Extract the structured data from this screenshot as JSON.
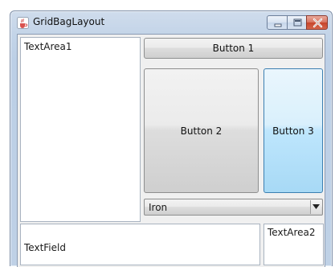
{
  "window": {
    "title": "GridBagLayout",
    "controls": {
      "minimize": "minimize-icon",
      "maximize": "maximize-icon",
      "close": "close-icon"
    }
  },
  "components": {
    "text_area_1": "TextArea1",
    "button_1": "Button 1",
    "button_2": "Button 2",
    "button_3": "Button 3",
    "combo": {
      "selected": "Iron"
    },
    "text_field": "TextField",
    "text_area_2": "TextArea2"
  },
  "icons": {
    "app": "java-cup-icon",
    "combo_arrow": "chevron-down-icon"
  },
  "colors": {
    "title_bar": "#c3d4e8",
    "close_button": "#c7442a",
    "focus_border": "#3c7fb1"
  }
}
